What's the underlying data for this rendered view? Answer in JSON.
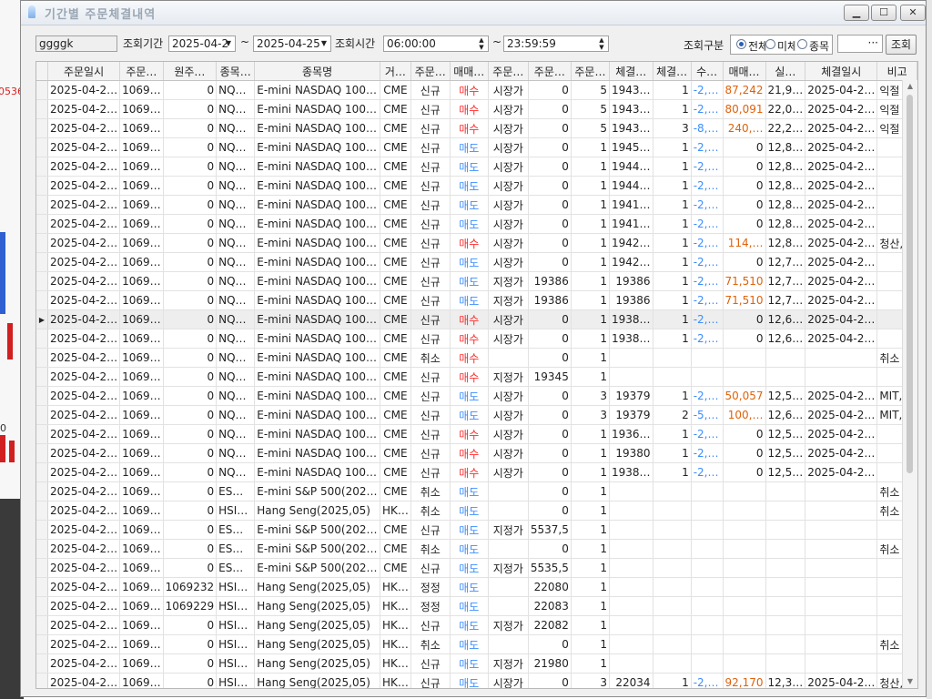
{
  "window": {
    "title": "기간별 주문체결내역",
    "buttons": {
      "minimize": "▁",
      "maximize": "☐",
      "close": "✕"
    }
  },
  "background": {
    "left_value": "0536",
    "left_value2": "0"
  },
  "toolbar": {
    "account": "ggggk",
    "period_label": "조회기간",
    "date_from": "2025-04-2",
    "tilde": "~",
    "date_to": "2025-04-25",
    "time_label": "조회시간",
    "time_from": "06:00:00",
    "time_to": "23:59:59",
    "category_label": "조회구분",
    "radio_all": "전체",
    "radio_unfilled": "미체결",
    "radio_item": "종목",
    "more_label": "···",
    "query_button": "조회"
  },
  "colors": {
    "buy": "#ff2a2a",
    "sell": "#3b8dff",
    "pnl": "#e0620a"
  },
  "table": {
    "headers": [
      "주문일시",
      "주문…",
      "원주…",
      "종목…",
      "종목명",
      "거…",
      "주문…",
      "매매…",
      "주문…",
      "주문…",
      "주문…",
      "체결…",
      "체결…",
      "수…",
      "매매…",
      "실…",
      "체결일시",
      "비고"
    ],
    "rows": [
      [
        "2025-04-2…",
        "1069…",
        "0",
        "NQ…",
        "E-mini NASDAQ 100…",
        "CME",
        "신규",
        "매수",
        "시장가",
        "0",
        "5",
        "1943…",
        "1",
        "-2,…",
        "87,242",
        "21,9…",
        "2025-04-2…",
        "익절"
      ],
      [
        "2025-04-2…",
        "1069…",
        "0",
        "NQ…",
        "E-mini NASDAQ 100…",
        "CME",
        "신규",
        "매수",
        "시장가",
        "0",
        "5",
        "1943…",
        "1",
        "-2,…",
        "80,091",
        "22,0…",
        "2025-04-2…",
        "익절"
      ],
      [
        "2025-04-2…",
        "1069…",
        "0",
        "NQ…",
        "E-mini NASDAQ 100…",
        "CME",
        "신규",
        "매수",
        "시장가",
        "0",
        "5",
        "1943…",
        "3",
        "-8,…",
        "240,…",
        "22,2…",
        "2025-04-2…",
        "익절"
      ],
      [
        "2025-04-2…",
        "1069…",
        "0",
        "NQ…",
        "E-mini NASDAQ 100…",
        "CME",
        "신규",
        "매도",
        "시장가",
        "0",
        "1",
        "1945…",
        "1",
        "-2,…",
        "0",
        "12,8…",
        "2025-04-2…",
        ""
      ],
      [
        "2025-04-2…",
        "1069…",
        "0",
        "NQ…",
        "E-mini NASDAQ 100…",
        "CME",
        "신규",
        "매도",
        "시장가",
        "0",
        "1",
        "1944…",
        "1",
        "-2,…",
        "0",
        "12,8…",
        "2025-04-2…",
        ""
      ],
      [
        "2025-04-2…",
        "1069…",
        "0",
        "NQ…",
        "E-mini NASDAQ 100…",
        "CME",
        "신규",
        "매도",
        "시장가",
        "0",
        "1",
        "1944…",
        "1",
        "-2,…",
        "0",
        "12,8…",
        "2025-04-2…",
        ""
      ],
      [
        "2025-04-2…",
        "1069…",
        "0",
        "NQ…",
        "E-mini NASDAQ 100…",
        "CME",
        "신규",
        "매도",
        "시장가",
        "0",
        "1",
        "1941…",
        "1",
        "-2,…",
        "0",
        "12,8…",
        "2025-04-2…",
        ""
      ],
      [
        "2025-04-2…",
        "1069…",
        "0",
        "NQ…",
        "E-mini NASDAQ 100…",
        "CME",
        "신규",
        "매도",
        "시장가",
        "0",
        "1",
        "1941…",
        "1",
        "-2,…",
        "0",
        "12,8…",
        "2025-04-2…",
        ""
      ],
      [
        "2025-04-2…",
        "1069…",
        "0",
        "NQ…",
        "E-mini NASDAQ 100…",
        "CME",
        "신규",
        "매수",
        "시장가",
        "0",
        "1",
        "1942…",
        "1",
        "-2,…",
        "114,…",
        "12,8…",
        "2025-04-2…",
        "청산,…"
      ],
      [
        "2025-04-2…",
        "1069…",
        "0",
        "NQ…",
        "E-mini NASDAQ 100…",
        "CME",
        "신규",
        "매도",
        "시장가",
        "0",
        "1",
        "1942…",
        "1",
        "-2,…",
        "0",
        "12,7…",
        "2025-04-2…",
        ""
      ],
      [
        "2025-04-2…",
        "1069…",
        "0",
        "NQ…",
        "E-mini NASDAQ 100…",
        "CME",
        "신규",
        "매도",
        "지정가",
        "19386",
        "1",
        "19386",
        "1",
        "-2,…",
        "71,510",
        "12,7…",
        "2025-04-2…",
        ""
      ],
      [
        "2025-04-2…",
        "1069…",
        "0",
        "NQ…",
        "E-mini NASDAQ 100…",
        "CME",
        "신규",
        "매도",
        "지정가",
        "19386",
        "1",
        "19386",
        "1",
        "-2,…",
        "71,510",
        "12,7…",
        "2025-04-2…",
        ""
      ],
      [
        "2025-04-2…",
        "1069…",
        "0",
        "NQ…",
        "E-mini NASDAQ 100…",
        "CME",
        "신규",
        "매수",
        "시장가",
        "0",
        "1",
        "1938…",
        "1",
        "-2,…",
        "0",
        "12,6…",
        "2025-04-2…",
        ""
      ],
      [
        "2025-04-2…",
        "1069…",
        "0",
        "NQ…",
        "E-mini NASDAQ 100…",
        "CME",
        "신규",
        "매수",
        "시장가",
        "0",
        "1",
        "1938…",
        "1",
        "-2,…",
        "0",
        "12,6…",
        "2025-04-2…",
        ""
      ],
      [
        "2025-04-2…",
        "1069…",
        "0",
        "NQ…",
        "E-mini NASDAQ 100…",
        "CME",
        "취소",
        "매수",
        "",
        "0",
        "1",
        "",
        "",
        "",
        "",
        "",
        "",
        "취소"
      ],
      [
        "2025-04-2…",
        "1069…",
        "0",
        "NQ…",
        "E-mini NASDAQ 100…",
        "CME",
        "신규",
        "매수",
        "지정가",
        "19345",
        "1",
        "",
        "",
        "",
        "",
        "",
        "",
        ""
      ],
      [
        "2025-04-2…",
        "1069…",
        "0",
        "NQ…",
        "E-mini NASDAQ 100…",
        "CME",
        "신규",
        "매도",
        "시장가",
        "0",
        "3",
        "19379",
        "1",
        "-2,…",
        "50,057",
        "12,5…",
        "2025-04-2…",
        "MIT,…"
      ],
      [
        "2025-04-2…",
        "1069…",
        "0",
        "NQ…",
        "E-mini NASDAQ 100…",
        "CME",
        "신규",
        "매도",
        "시장가",
        "0",
        "3",
        "19379",
        "2",
        "-5,…",
        "100,…",
        "12,6…",
        "2025-04-2…",
        "MIT,…"
      ],
      [
        "2025-04-2…",
        "1069…",
        "0",
        "NQ…",
        "E-mini NASDAQ 100…",
        "CME",
        "신규",
        "매수",
        "시장가",
        "0",
        "1",
        "1936…",
        "1",
        "-2,…",
        "0",
        "12,5…",
        "2025-04-2…",
        ""
      ],
      [
        "2025-04-2…",
        "1069…",
        "0",
        "NQ…",
        "E-mini NASDAQ 100…",
        "CME",
        "신규",
        "매수",
        "시장가",
        "0",
        "1",
        "19380",
        "1",
        "-2,…",
        "0",
        "12,5…",
        "2025-04-2…",
        ""
      ],
      [
        "2025-04-2…",
        "1069…",
        "0",
        "NQ…",
        "E-mini NASDAQ 100…",
        "CME",
        "신규",
        "매수",
        "시장가",
        "0",
        "1",
        "1938…",
        "1",
        "-2,…",
        "0",
        "12,5…",
        "2025-04-2…",
        ""
      ],
      [
        "2025-04-2…",
        "1069…",
        "0",
        "ES…",
        "E-mini S&P 500(202…",
        "CME",
        "취소",
        "매도",
        "",
        "0",
        "1",
        "",
        "",
        "",
        "",
        "",
        "",
        "취소"
      ],
      [
        "2025-04-2…",
        "1069…",
        "0",
        "HSI…",
        "Hang Seng(2025,05)",
        "HK…",
        "취소",
        "매도",
        "",
        "0",
        "1",
        "",
        "",
        "",
        "",
        "",
        "",
        "취소"
      ],
      [
        "2025-04-2…",
        "1069…",
        "0",
        "ES…",
        "E-mini S&P 500(202…",
        "CME",
        "신규",
        "매도",
        "지정가",
        "5537,5",
        "1",
        "",
        "",
        "",
        "",
        "",
        "",
        ""
      ],
      [
        "2025-04-2…",
        "1069…",
        "0",
        "ES…",
        "E-mini S&P 500(202…",
        "CME",
        "취소",
        "매도",
        "",
        "0",
        "1",
        "",
        "",
        "",
        "",
        "",
        "",
        "취소"
      ],
      [
        "2025-04-2…",
        "1069…",
        "0",
        "ES…",
        "E-mini S&P 500(202…",
        "CME",
        "신규",
        "매도",
        "지정가",
        "5535,5",
        "1",
        "",
        "",
        "",
        "",
        "",
        "",
        ""
      ],
      [
        "2025-04-2…",
        "1069…",
        "1069232",
        "HSI…",
        "Hang Seng(2025,05)",
        "HK…",
        "정정",
        "매도",
        "",
        "22080",
        "1",
        "",
        "",
        "",
        "",
        "",
        "",
        ""
      ],
      [
        "2025-04-2…",
        "1069…",
        "1069229",
        "HSI…",
        "Hang Seng(2025,05)",
        "HK…",
        "정정",
        "매도",
        "",
        "22083",
        "1",
        "",
        "",
        "",
        "",
        "",
        "",
        ""
      ],
      [
        "2025-04-2…",
        "1069…",
        "0",
        "HSI…",
        "Hang Seng(2025,05)",
        "HK…",
        "신규",
        "매도",
        "지정가",
        "22082",
        "1",
        "",
        "",
        "",
        "",
        "",
        "",
        ""
      ],
      [
        "2025-04-2…",
        "1069…",
        "0",
        "HSI…",
        "Hang Seng(2025,05)",
        "HK…",
        "취소",
        "매도",
        "",
        "0",
        "1",
        "",
        "",
        "",
        "",
        "",
        "",
        "취소"
      ],
      [
        "2025-04-2…",
        "1069…",
        "0",
        "HSI…",
        "Hang Seng(2025,05)",
        "HK…",
        "신규",
        "매도",
        "지정가",
        "21980",
        "1",
        "",
        "",
        "",
        "",
        "",
        "",
        ""
      ],
      [
        "2025-04-2…",
        "1069…",
        "0",
        "HSI…",
        "Hang Seng(2025,05)",
        "HK…",
        "신규",
        "매도",
        "시장가",
        "0",
        "3",
        "22034",
        "1",
        "-2,…",
        "92,170",
        "12,3…",
        "2025-04-2…",
        "청산,…"
      ]
    ],
    "selected_row_marker": "▶"
  },
  "scroll": {
    "up": "▲",
    "down": "▼"
  }
}
